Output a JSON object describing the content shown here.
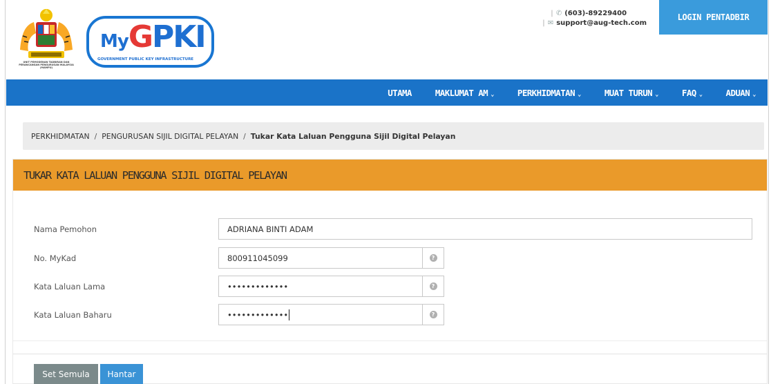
{
  "header": {
    "crest_caption": "UNIT PEMODENAN TADBIRAN DAN PERANCANGAN PENGURUSAN MALAYSIA (MAMPU)",
    "logo_text_my": "My",
    "logo_text_g": "G",
    "logo_text_pki": "PKI",
    "logo_subtitle": "GOVERNMENT PUBLIC KEY INFRASTRUCTURE",
    "phone": "(603)-89229400",
    "email": "support@aug-tech.com",
    "login_label": "LOGIN PENTADBIR"
  },
  "nav": {
    "items": [
      {
        "label": "UTAMA",
        "dropdown": false
      },
      {
        "label": "MAKLUMAT AM",
        "dropdown": true
      },
      {
        "label": "PERKHIDMATAN",
        "dropdown": true
      },
      {
        "label": "MUAT TURUN",
        "dropdown": true
      },
      {
        "label": "FAQ",
        "dropdown": true
      },
      {
        "label": "ADUAN",
        "dropdown": true
      }
    ],
    "chevron": "⌄"
  },
  "breadcrumb": {
    "items": [
      "PERKHIDMATAN",
      "PENGURUSAN SIJIL DIGITAL PELAYAN"
    ],
    "separator": "/",
    "current": "Tukar Kata Laluan Pengguna Sijil Digital Pelayan"
  },
  "panel": {
    "title": "TUKAR KATA LALUAN PENGGUNA SIJIL DIGITAL PELAYAN"
  },
  "form": {
    "name_label": "Nama Pemohon",
    "name_value": "ADRIANA BINTI ADAM",
    "mykad_label": "No. MyKad",
    "mykad_value": "800911045099",
    "old_pw_label": "Kata Laluan Lama",
    "old_pw_value": "•••••••••••••",
    "new_pw_label": "Kata Laluan Baharu",
    "new_pw_value": "•••••••••••••",
    "help_glyph": "?"
  },
  "actions": {
    "reset_label": "Set Semula",
    "submit_label": "Hantar"
  },
  "colors": {
    "nav_bg": "#1a73c8",
    "panel_header": "#ea9a2a",
    "login_bg": "#3a9bdc",
    "reset_bg": "#7b8a8b",
    "submit_bg": "#3a93d6"
  }
}
